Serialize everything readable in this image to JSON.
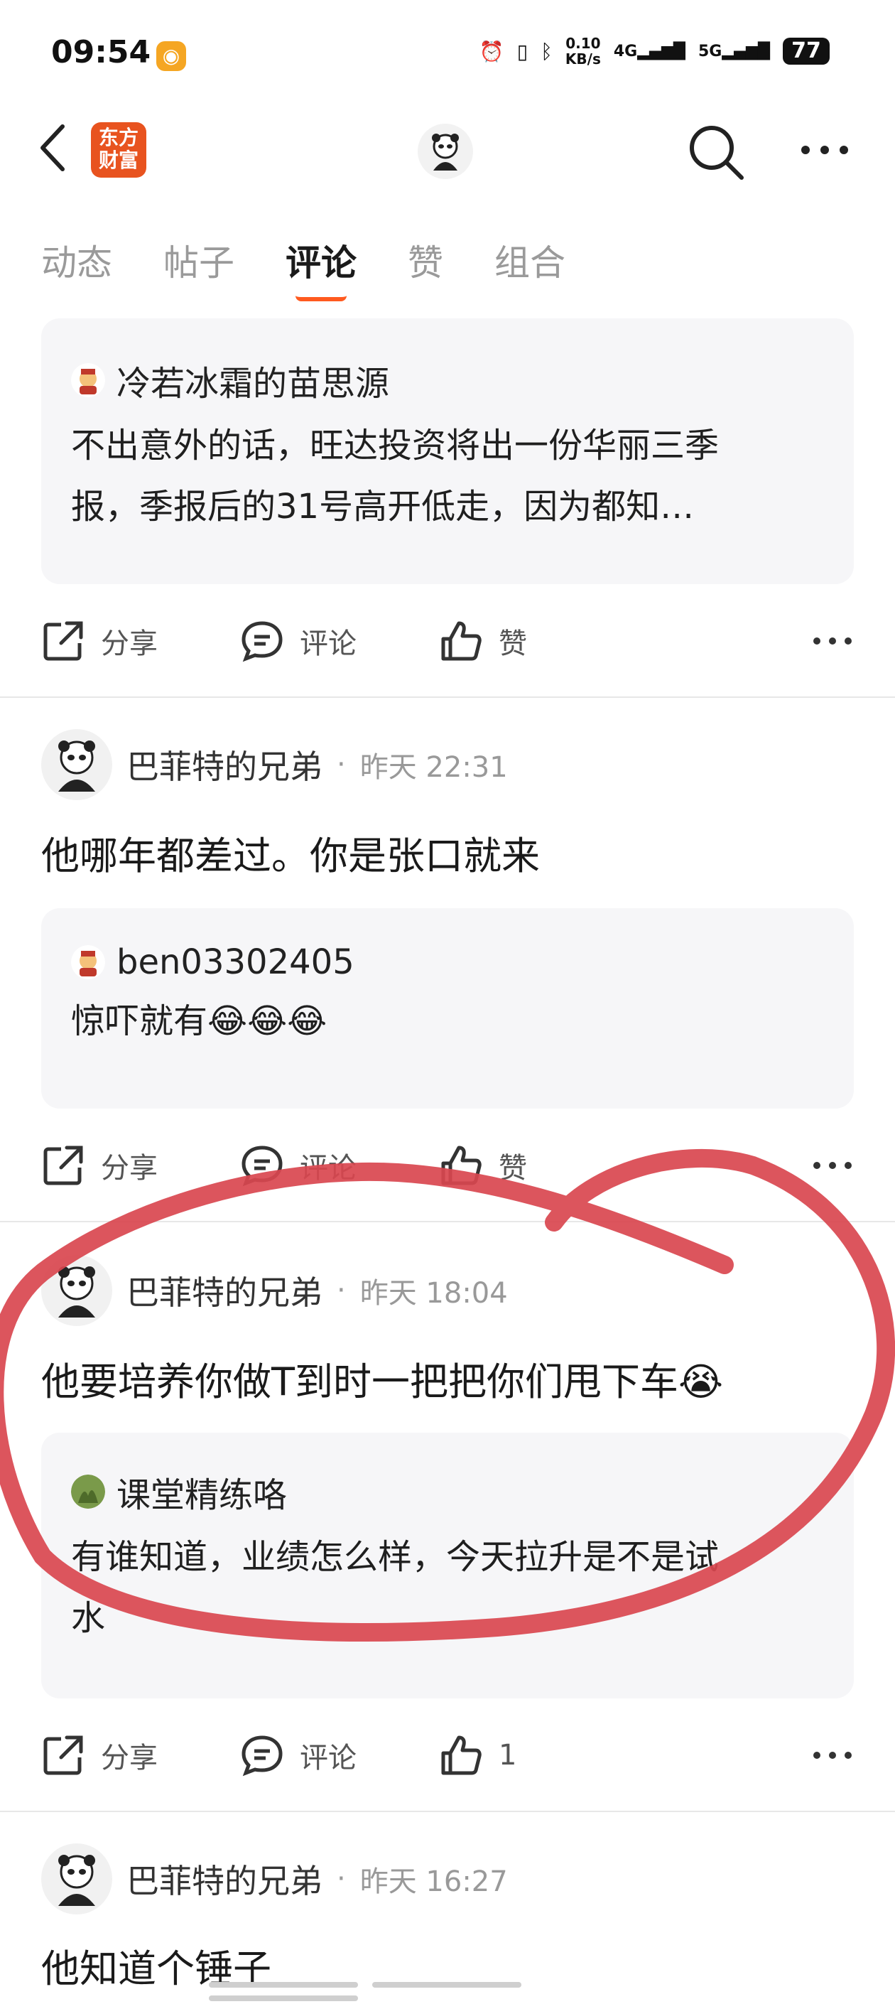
{
  "status_bar": {
    "time": "09:54",
    "net_speed_value": "0.10",
    "net_speed_unit": "KB/s",
    "net_4g": "4G",
    "net_5g": "5G",
    "battery": "77"
  },
  "header": {
    "brand_line1": "东方",
    "brand_line2": "财富"
  },
  "tabs": [
    {
      "label": "动态",
      "active": false
    },
    {
      "label": "帖子",
      "active": false
    },
    {
      "label": "评论",
      "active": true
    },
    {
      "label": "赞",
      "active": false
    },
    {
      "label": "组合",
      "active": false
    }
  ],
  "actions": {
    "share": "分享",
    "comment": "评论",
    "like": "赞"
  },
  "items": [
    {
      "quote": {
        "name": "冷若冰霜的苗思源",
        "line1": "不出意外的话，旺达投资将出一份华丽三季",
        "line2": "报，季报后的31号高开低走，因为都知…"
      },
      "like_label": "赞"
    },
    {
      "user": "巴菲特的兄弟",
      "dot": "·",
      "time": "昨天 22:31",
      "comment": "他哪年都差过。你是张口就来",
      "quote": {
        "name": "ben03302405",
        "line1": "惊吓就有😂😂😂"
      },
      "like_label": "赞"
    },
    {
      "user": "巴菲特的兄弟",
      "dot": "·",
      "time": "昨天 18:04",
      "comment": "他要培养你做T到时一把把你们甩下车😭",
      "quote": {
        "name": "课堂精练咯",
        "line1": "有谁知道，业绩怎么样，今天拉升是不是试",
        "line2": "水"
      },
      "like_label": "1"
    },
    {
      "user": "巴菲特的兄弟",
      "dot": "·",
      "time": "昨天 16:27",
      "comment": "他知道个锤子"
    }
  ],
  "colors": {
    "accent": "#ff5a1f",
    "brand": "#e8531f",
    "markup_stroke": "#d9474f",
    "card_bg": "#f6f6f8"
  }
}
